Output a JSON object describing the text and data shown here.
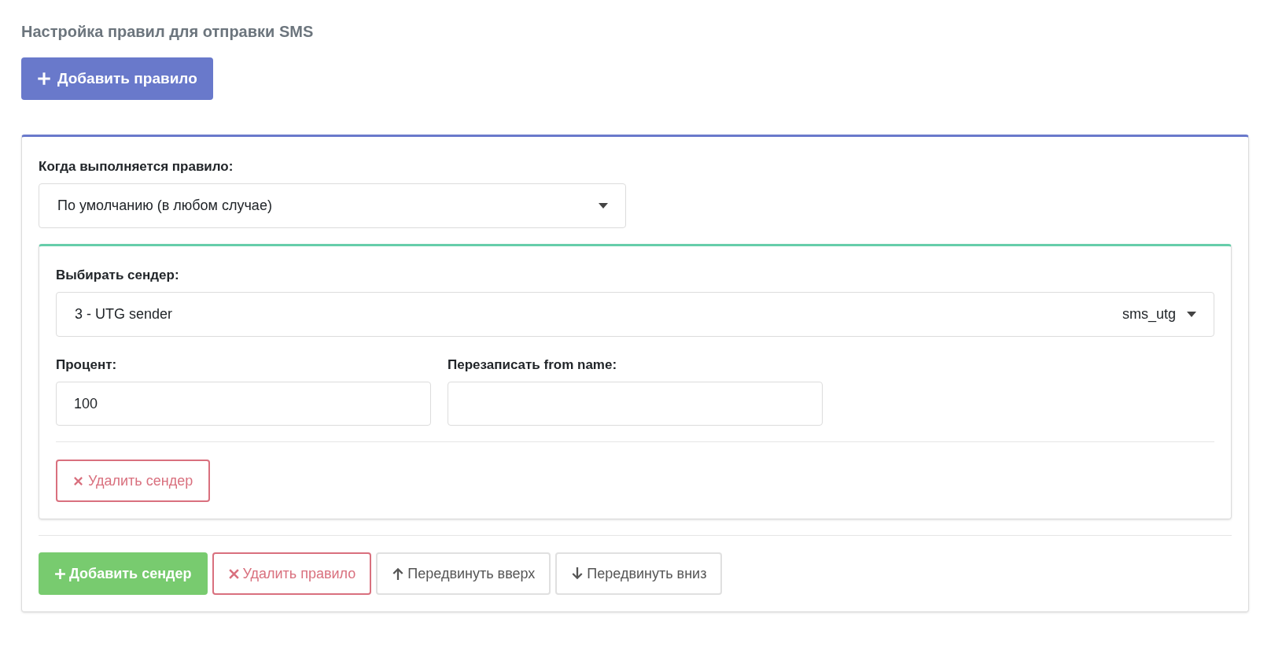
{
  "page_title": "Настройка правил для отправки SMS",
  "add_rule_button": {
    "label": "Добавить правило"
  },
  "rule": {
    "condition_label": "Когда выполняется правило:",
    "condition_value": "По умолчанию (в любом случае)",
    "senders": [
      {
        "sender_label": "Выбирать сендер:",
        "sender_value": "3 - UTG sender",
        "sender_code": "sms_utg",
        "percent_label": "Процент:",
        "percent_value": "100",
        "from_name_label": "Перезаписать from name:",
        "delete_button": {
          "label": "Удалить сендер"
        }
      }
    ],
    "actions": [
      {
        "kind": "add",
        "label": "Добавить сендер"
      },
      {
        "kind": "delete",
        "label": "Удалить правило"
      },
      {
        "kind": "move_up",
        "label": "Передвинуть вверх"
      },
      {
        "kind": "move_down",
        "label": "Передвинуть вниз"
      }
    ]
  }
}
